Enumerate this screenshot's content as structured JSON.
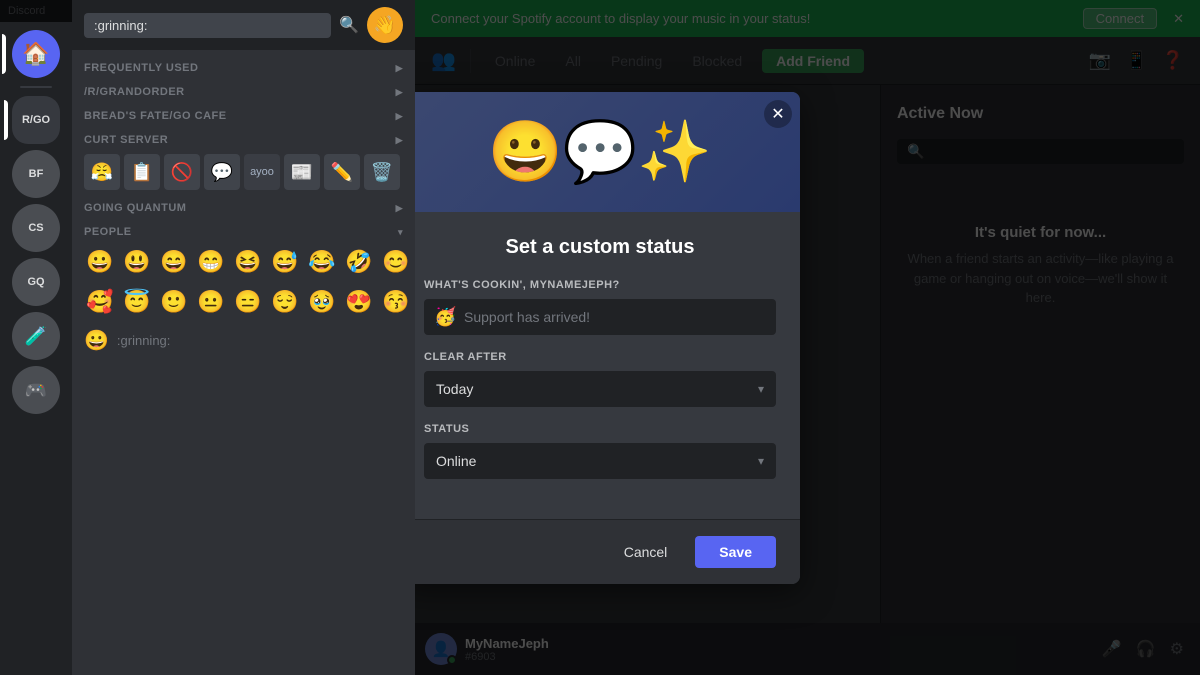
{
  "app": {
    "title": "Discord"
  },
  "titlebar": {
    "title": "Discord",
    "minimize": "─",
    "restore": "□",
    "close": "✕"
  },
  "emoji_picker": {
    "search_placeholder": ":grinning:",
    "search_value": ":grinning:",
    "wave_emoji": "👋",
    "sections": {
      "frequently_used": {
        "label": "FREQUENTLY USED",
        "has_arrow": true
      },
      "grandorder": {
        "label": "/R/GRANDORDER",
        "has_arrow": true
      },
      "breads_fate": {
        "label": "BREAD'S FATE/GO CAFE",
        "has_arrow": true
      },
      "curt_server": {
        "label": "CURT SERVER",
        "has_arrow": true
      },
      "going_quantum": {
        "label": "GOING QUANTUM",
        "has_arrow": true
      },
      "people": {
        "label": "PEOPLE",
        "has_arrow": true
      }
    },
    "custom_emojis_row1": [
      "😀",
      "😃",
      "😄",
      "😁",
      "😆",
      "😅",
      "😂",
      "🤣",
      "😊"
    ],
    "custom_emojis_row2": [
      "🥰",
      "😇",
      "🙂",
      "😐",
      "😑",
      "😌",
      "🥹",
      "😍",
      "😚"
    ],
    "emoji_label": ":grinning:",
    "emoji_label_icon": "😀"
  },
  "servers": {
    "home": "🏠",
    "list": [
      {
        "id": "s1",
        "label": "R/GO",
        "bg": "#5865f2",
        "text_color": "#fff"
      },
      {
        "id": "s2",
        "label": "BF",
        "bg": "#2d2f34",
        "text_color": "#fff"
      },
      {
        "id": "s3",
        "label": "CS",
        "bg": "#2d2f34",
        "text_color": "#dcddde"
      },
      {
        "id": "s4",
        "label": "GQ",
        "bg": "#2d2f34",
        "text_color": "#dcddde"
      },
      {
        "id": "s5",
        "label": "🧪",
        "bg": "#2d2f34",
        "text_color": "#dcddde"
      },
      {
        "id": "s6",
        "label": "🎮",
        "bg": "#2d2f34",
        "text_color": "#dcddde"
      }
    ]
  },
  "channel_sidebar": {
    "server_name": "CURT SERVER",
    "sections": []
  },
  "friends_bar": {
    "icon": "👥",
    "tabs": [
      {
        "label": "Online",
        "active": false
      },
      {
        "label": "All",
        "active": false
      },
      {
        "label": "Pending",
        "active": false
      },
      {
        "label": "Blocked",
        "active": false
      }
    ],
    "add_friend_label": "Add Friend",
    "icons": [
      "📷",
      "📱",
      "❓"
    ]
  },
  "spotify_banner": {
    "text": "Connect your Spotify account to display your music in your status!",
    "connect_label": "Connect",
    "close": "✕"
  },
  "active_now": {
    "title": "Active Now",
    "search_placeholder": "",
    "empty_title": "It's quiet for now...",
    "empty_desc": "When a friend starts an activity—like playing a game or hanging out on voice—we'll show it here."
  },
  "modal": {
    "title": "Set a custom status",
    "subtitle_label": "WHAT'S COOKIN', MYNAMEJEPH?",
    "input_placeholder": "Support has arrived!",
    "input_emoji": "🥳",
    "clear_after_label": "CLEAR AFTER",
    "clear_after_value": "Today",
    "status_label": "STATUS",
    "status_value": "Online",
    "cancel_label": "Cancel",
    "save_label": "Save",
    "close_icon": "✕"
  },
  "user_bar": {
    "avatar_emoji": "👤",
    "name": "MyNameJeph",
    "tag": "#6903",
    "mic_icon": "🎤",
    "headset_icon": "🎧",
    "settings_icon": "⚙"
  }
}
